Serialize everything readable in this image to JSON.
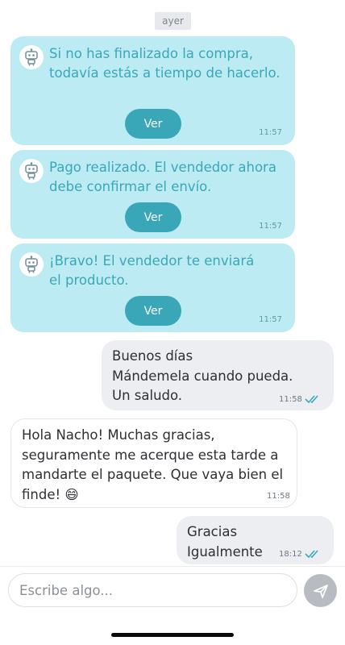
{
  "chat": {
    "date_label": "ayer",
    "bot_messages": [
      {
        "text": "Si no has finalizado la compra,\ntodavía estás a tiempo de hacerlo.",
        "button": "Ver",
        "time": "11:57"
      },
      {
        "text": "Pago realizado. El vendedor ahora\ndebe confirmar el envío.",
        "button": "Ver",
        "time": "11:57"
      },
      {
        "text": "¡Bravo! El vendedor te enviará\nel producto.",
        "button": "Ver",
        "time": "11:57"
      }
    ],
    "messages": [
      {
        "direction": "outgoing",
        "text": "Buenos días\nMándemela cuando pueda.\nUn saludo.",
        "time": "11:58",
        "status": "read"
      },
      {
        "direction": "incoming",
        "text": "Hola Nacho! Muchas gracias,\nseguramente me acerque esta tarde a\nmandarte el paquete. Que vaya bien el\nfinde! 😄",
        "time": "11:58"
      },
      {
        "direction": "outgoing",
        "text": "Gracias\nIgualmente",
        "time": "18:12",
        "status": "read"
      }
    ]
  },
  "composer": {
    "placeholder": "Escribe algo...",
    "send_icon": "send-icon"
  },
  "colors": {
    "bot_bubble": "#bdebf3",
    "bot_text": "#3aa7b8",
    "accent": "#3aa7b8",
    "outgoing_bubble": "#eceef1",
    "read_ticks": "#3aa7b8"
  }
}
